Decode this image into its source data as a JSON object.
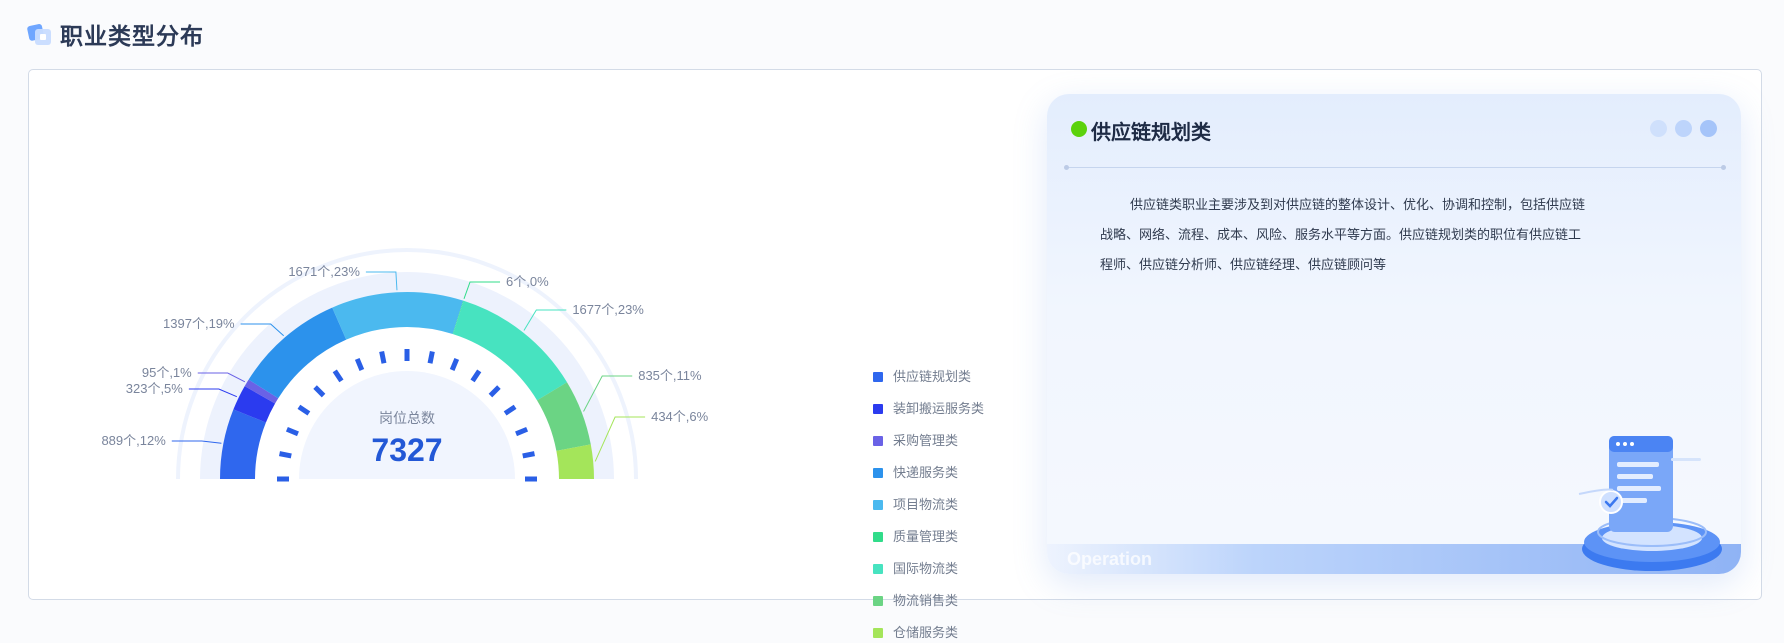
{
  "page": {
    "title": "职业类型分布"
  },
  "chart_data": {
    "type": "pie",
    "total_label": "岗位总数",
    "total_value": "7327",
    "slices": [
      {
        "name": "供应链规划类",
        "value": 889,
        "label": "889个,12%",
        "color": "#2f67ee"
      },
      {
        "name": "装卸搬运服务类",
        "value": 323,
        "label": "323个,5%",
        "color": "#2b3bef"
      },
      {
        "name": "采购管理类",
        "value": 95,
        "label": "95个,1%",
        "color": "#6a62e6"
      },
      {
        "name": "快递服务类",
        "value": 1397,
        "label": "1397个,19%",
        "color": "#2c92ec"
      },
      {
        "name": "项目物流类",
        "value": 1671,
        "label": "1671个,23%",
        "color": "#4bb9ef"
      },
      {
        "name": "质量管理类",
        "value": 6,
        "label": "6个,0%",
        "color": "#31dc8a"
      },
      {
        "name": "国际物流类",
        "value": 1677,
        "label": "1677个,23%",
        "color": "#47e3c0"
      },
      {
        "name": "物流销售类",
        "value": 835,
        "label": "835个,11%",
        "color": "#6bd484"
      },
      {
        "name": "仓储服务类",
        "value": 434,
        "label": "434个,6%",
        "color": "#a4e55a"
      }
    ]
  },
  "detail_card": {
    "title": "供应链规划类",
    "description": "供应链类职业主要涉及到对供应链的整体设计、优化、协调和控制，包括供应链战略、网络、流程、成本、风险、服务水平等方面。供应链规划类的职位有供应链工程师、供应链分析师、供应链经理、供应链顾问等",
    "watermark": "Operation",
    "status_color": "#5bd20c"
  }
}
